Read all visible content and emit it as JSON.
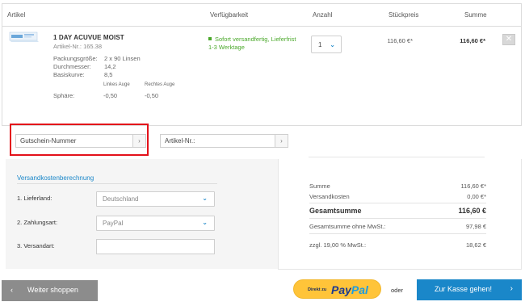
{
  "table": {
    "headers": {
      "article": "Artikel",
      "availability": "Verfügbarkeit",
      "quantity": "Anzahl",
      "unit_price": "Stückpreis",
      "sum": "Summe"
    }
  },
  "product": {
    "name": "1 DAY ACUVUE MOIST",
    "article_no": "Artikel-Nr.: 165.38",
    "specs": [
      {
        "label": "Packungsgröße:",
        "value": "2 x 90 Linsen"
      },
      {
        "label": "Durchmesser:",
        "value": "14,2"
      },
      {
        "label": "Basiskurve:",
        "value": "8,5"
      }
    ],
    "left_eye_label": "Linkes Auge",
    "right_eye_label": "Rechtes Auge",
    "sphere_label": "Sphäre:",
    "sphere_left": "-0,50",
    "sphere_right": "-0,50",
    "availability_line1": "Sofort versandfertig, Lieferfrist",
    "availability_line2": "1-3 Werktage",
    "quantity": "1",
    "unit_price": "116,60 €*",
    "sum": "116,60 €*",
    "remove_icon": "✕",
    "thumbnail_icon": "contact-lens-box-icon"
  },
  "voucher": {
    "placeholder": "Gutschein-Nummer",
    "button": "›"
  },
  "article_field": {
    "placeholder": "Artikel-Nr.:",
    "button": "›"
  },
  "shipping": {
    "title": "Versandkostenberechnung",
    "country_label": "1. Lieferland:",
    "country_value": "Deutschland",
    "payment_label": "2. Zahlungsart:",
    "payment_value": "PayPal",
    "dispatch_label": "3. Versandart:",
    "chevron": "⌄"
  },
  "totals": {
    "sum_label": "Summe",
    "sum_value": "116,60 €*",
    "shipping_label": "Versandkosten",
    "shipping_value": "0,00 €*",
    "total_label": "Gesamtsumme",
    "total_value": "116,60 €",
    "net_label": "Gesamtsumme ohne MwSt.:",
    "net_value": "97,98 €",
    "tax_label": "zzgl. 19,00 % MwSt.:",
    "tax_value": "18,62 €"
  },
  "actions": {
    "back_label": "Weiter shoppen",
    "back_arrow": "‹",
    "paypal_direct": "Direkt zu",
    "paypal_pay": "Pay",
    "paypal_pal": "Pal",
    "or_label": "oder",
    "checkout_label": "Zur Kasse gehen!",
    "checkout_arrow": "›"
  },
  "colors": {
    "accent": "#1a87c9",
    "available": "#4aa82a",
    "highlight": "#e3111a",
    "paypal_yellow": "#ffc439"
  }
}
